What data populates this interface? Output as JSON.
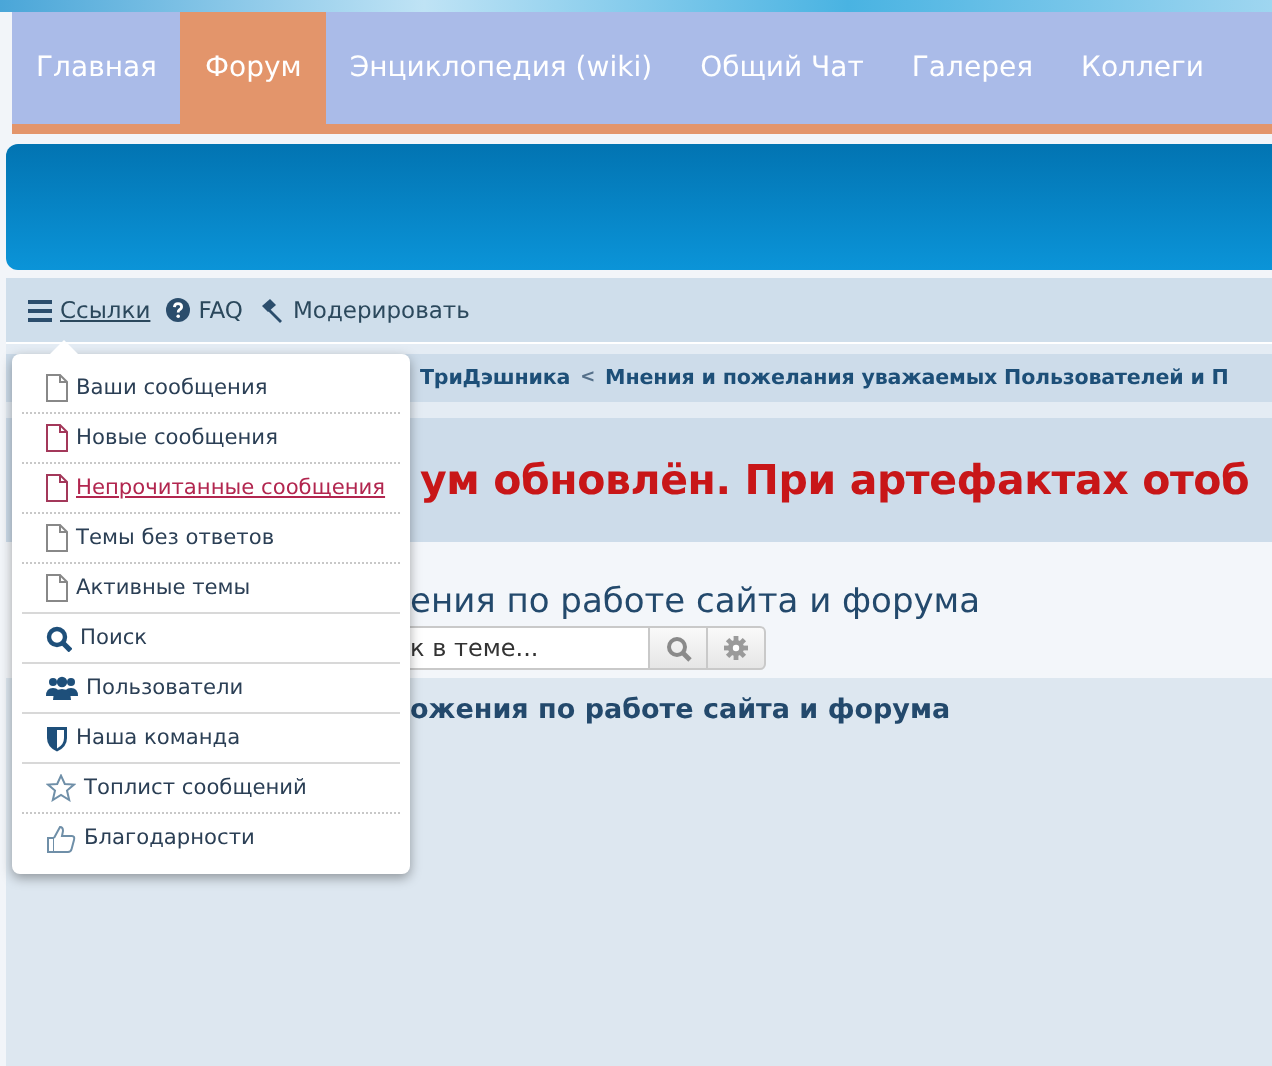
{
  "nav_tabs": [
    {
      "label": "Главная",
      "selected": false
    },
    {
      "label": "Форум",
      "selected": true
    },
    {
      "label": "Энциклопедия (wiki)",
      "selected": false
    },
    {
      "label": "Общий Чат",
      "selected": false
    },
    {
      "label": "Галерея",
      "selected": false
    },
    {
      "label": "Коллеги",
      "selected": false
    }
  ],
  "toolbar": [
    {
      "kind": "menu",
      "label": "Ссылки"
    },
    {
      "kind": "help",
      "label": "FAQ"
    },
    {
      "kind": "hammer",
      "label": "Модерировать"
    }
  ],
  "breadcrumb": [
    "ТриДэшника",
    "Мнения и пожелания уважаемых Пользователей и П"
  ],
  "breadcrumb_separator": "<",
  "notice": "ум обновлён. При артефактах отоб",
  "thread_title": "ения по работе сайта и форума",
  "search": {
    "placeholder": "к в теме..."
  },
  "section_heading": "ожения по работе сайта и форума",
  "dropdown": {
    "groups": [
      [
        {
          "kind": "page",
          "label": "Ваши сообщения",
          "color": "#888888",
          "selected": false
        },
        {
          "kind": "page",
          "label": "Новые сообщения",
          "color": "#a3385a",
          "selected": false
        },
        {
          "kind": "page",
          "label": "Непрочитанные сообщения",
          "color": "#a3385a",
          "selected": true
        },
        {
          "kind": "page",
          "label": "Темы без ответов",
          "color": "#888888",
          "selected": false
        },
        {
          "kind": "page",
          "label": "Активные темы",
          "color": "#888888",
          "selected": false
        }
      ],
      [
        {
          "kind": "search",
          "label": "Поиск",
          "color": "#1e4f7a",
          "selected": false
        }
      ],
      [
        {
          "kind": "users",
          "label": "Пользователи",
          "color": "#1e4f7a",
          "selected": false
        }
      ],
      [
        {
          "kind": "shield",
          "label": "Наша команда",
          "color": "#1e4f7a",
          "selected": false
        }
      ],
      [
        {
          "kind": "star",
          "label": "Топлист сообщений",
          "color": "#6f8fa8",
          "selected": false
        },
        {
          "kind": "thumb",
          "label": "Благодарности",
          "color": "#6f8fa8",
          "selected": false
        }
      ]
    ]
  }
}
